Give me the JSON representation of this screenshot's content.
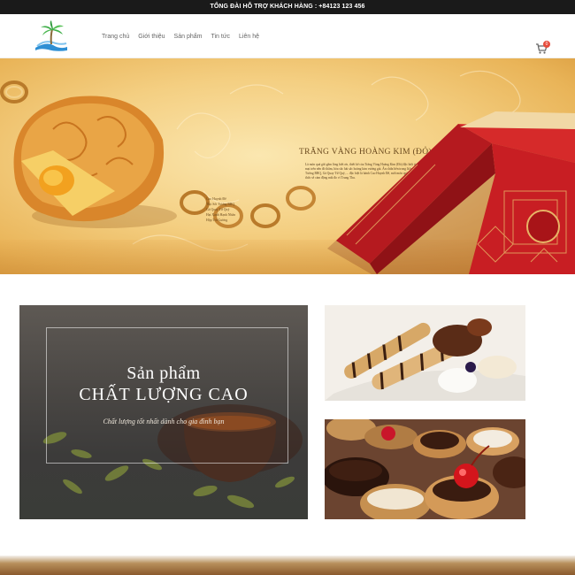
{
  "topbar": {
    "text": "TỔNG ĐÀI HỖ TRỢ KHÁCH HÀNG : +84123 123 456"
  },
  "nav": {
    "items": [
      {
        "label": "Trang chủ"
      },
      {
        "label": "Giới thiệu"
      },
      {
        "label": "Sản phẩm"
      },
      {
        "label": "Tin tức"
      },
      {
        "label": "Liên hệ"
      }
    ]
  },
  "cart": {
    "count": "0",
    "icon": "cart-icon"
  },
  "logo": {
    "icon": "palm-island-logo"
  },
  "banner": {
    "title": "TRĂNG VÀNG HOÀNG KIM (ĐỎ)",
    "description": "Là món quà gửi gắm lòng biết ơn, thiết kế của Trăng Vàng Hoàng Kim (Đỏ) đặc biệt tỏ với những nét hoa tiết miên mại trên nền đỏ thắm, hòa sắc hài sắc hoàng kim vương giả. Ẩn chứa bên trong là hương vị đặc đáo của Thịt Sốt Tương BBQ, Gà Quay Tứ Quý, ... đặc biệt là bánh Cao Huynh Đế, mới món quà quý của kiến từ khiến người thưởng thức sẽ cảm động mãi đo vì Trung Thu.",
    "items": [
      "Cao Huynh Đế",
      "Thịt Sốt Tương BBQ",
      "Gà Quay Tứ Quý",
      "Hạt Xanh Hạnh Nhân",
      "Hộp Trà Gương"
    ],
    "colors": {
      "gold": "#f4cf82",
      "red": "#c81e23"
    }
  },
  "promo": {
    "subtitle": "Sản phẩm",
    "title": "CHẤT LƯỢNG CAO",
    "tagline": "Chất lượng tốt nhất dành cho gia đình bạn"
  }
}
